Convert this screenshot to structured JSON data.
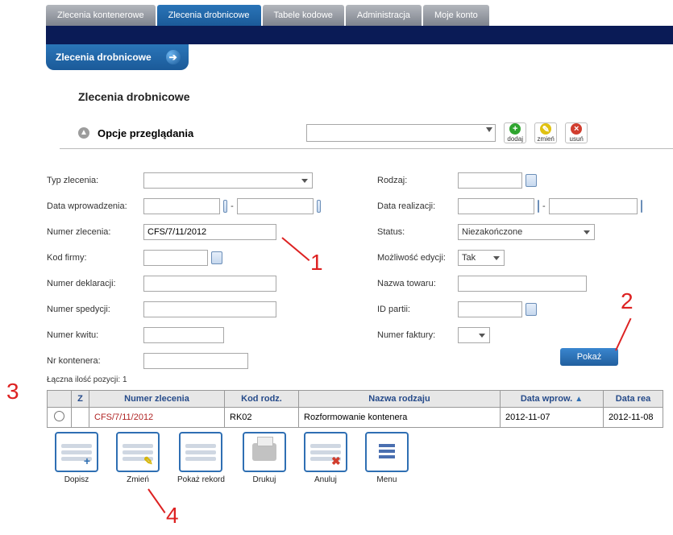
{
  "nav": {
    "tabs": [
      "Zlecenia kontenerowe",
      "Zlecenia drobnicowe",
      "Tabele kodowe",
      "Administracja",
      "Moje konto"
    ],
    "active_index": 1
  },
  "subheader": {
    "title": "Zlecenia drobnicowe"
  },
  "page_title": "Zlecenia drobnicowe",
  "opcje": {
    "label": "Opcje przeglądania",
    "select_value": "",
    "btn_add": "dodaj",
    "btn_edit": "zmień",
    "btn_del": "usuń"
  },
  "form": {
    "left": {
      "typ_zlecenia": {
        "label": "Typ zlecenia:",
        "value": ""
      },
      "data_wprowadzenia": {
        "label": "Data wprowadzenia:",
        "from": "",
        "to": ""
      },
      "numer_zlecenia": {
        "label": "Numer zlecenia:",
        "value": "CFS/7/11/2012"
      },
      "kod_firmy": {
        "label": "Kod firmy:",
        "value": ""
      },
      "numer_deklaracji": {
        "label": "Numer deklaracji:",
        "value": ""
      },
      "numer_spedycji": {
        "label": "Numer spedycji:",
        "value": ""
      },
      "numer_kwitu": {
        "label": "Numer kwitu:",
        "value": ""
      },
      "nr_kontenera": {
        "label": "Nr kontenera:",
        "value": ""
      }
    },
    "right": {
      "rodzaj": {
        "label": "Rodzaj:",
        "value": ""
      },
      "data_realizacji": {
        "label": "Data realizacji:",
        "from": "",
        "to": ""
      },
      "status": {
        "label": "Status:",
        "value": "Niezakończone"
      },
      "mozliwosc_edycji": {
        "label": "Możliwość edycji:",
        "value": "Tak"
      },
      "nazwa_towaru": {
        "label": "Nazwa towaru:",
        "value": ""
      },
      "id_partii": {
        "label": "ID partii:",
        "value": ""
      },
      "numer_faktury": {
        "label": "Numer faktury:",
        "value": ""
      }
    },
    "submit": "Pokaż"
  },
  "counts": {
    "label": "Łączna ilość pozycji:",
    "value": "1"
  },
  "table": {
    "headers": [
      "",
      "Z",
      "Numer zlecenia",
      "Kod rodz.",
      "Nazwa rodzaju",
      "Data wprow.",
      "Data rea"
    ],
    "rows": [
      {
        "z": "",
        "numer": "CFS/7/11/2012",
        "kod": "RK02",
        "nazwa": "Rozformowanie kontenera",
        "data_wprow": "2012-11-07",
        "data_rea": "2012-11-08"
      }
    ]
  },
  "actions": {
    "dopisz": "Dopisz",
    "zmien": "Zmień",
    "pokaz_rekord": "Pokaż rekord",
    "drukuj": "Drukuj",
    "anuluj": "Anuluj",
    "menu": "Menu"
  },
  "annotations": {
    "n1": "1",
    "n2": "2",
    "n3": "3",
    "n4": "4"
  }
}
